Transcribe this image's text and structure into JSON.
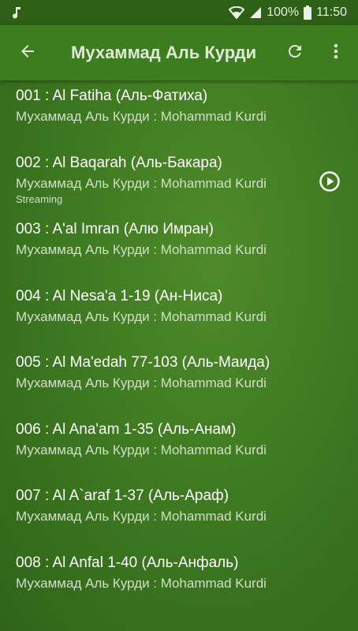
{
  "status_bar": {
    "battery_percent": "100%",
    "time": "11:50"
  },
  "header": {
    "title": "Мухаммад Аль Курди"
  },
  "tracks": [
    {
      "title": "001 : Al Fatiha (Аль-Фатиха)",
      "artist": "Мухаммад Аль Курди : Mohammad Kurdi"
    },
    {
      "title": "002 : Al Baqarah (Аль-Бакара)",
      "artist": "Мухаммад Аль Курди : Mohammad Kurdi",
      "status": "Streaming"
    },
    {
      "title": "003 : A'al Imran (Алю Имран)",
      "artist": "Мухаммад Аль Курди : Mohammad Kurdi"
    },
    {
      "title": "004 : Al Nesa'a 1-19 (Ан-Ниса)",
      "artist": "Мухаммад Аль Курди : Mohammad Kurdi"
    },
    {
      "title": "005 : Al Ma'edah 77-103 (Аль-Маида)",
      "artist": "Мухаммад Аль Курди : Mohammad Kurdi"
    },
    {
      "title": "006 :  Al Ana'am 1-35 (Аль-Анам)",
      "artist": "Мухаммад Аль Курди : Mohammad Kurdi"
    },
    {
      "title": "007 : Al A`araf 1-37 (Аль-Араф)",
      "artist": "Мухаммад Аль Курди : Mohammad Kurdi"
    },
    {
      "title": "008 : Al Anfal 1-40 (Аль-Анфаль)",
      "artist": "Мухаммад Аль Курди : Mohammad Kurdi"
    }
  ],
  "icons": {
    "status_left": "music-note-icon",
    "wifi": "wifi-icon",
    "signal": "signal-icon",
    "battery": "battery-icon",
    "back": "arrow-back-icon",
    "refresh": "refresh-icon",
    "menu": "more-vert-icon",
    "play": "play-circle-icon"
  },
  "colors": {
    "status_bar": "#2e5f16",
    "app_bar": "#3d7d1f",
    "background": "#3f7a22",
    "title_text": "#ffffff",
    "subtitle_text": "#d2dfc8"
  }
}
